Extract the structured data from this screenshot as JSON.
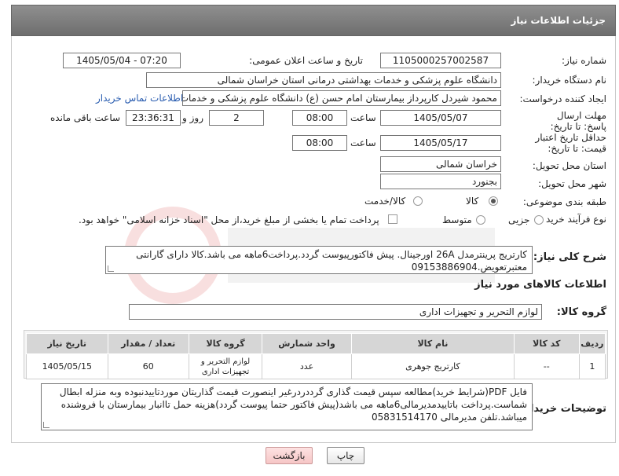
{
  "header": {
    "title": "جزئیات اطلاعات نیاز"
  },
  "labels": {
    "need_number": "شماره نیاز:",
    "announce_datetime": "تاریخ و ساعت اعلان عمومی:",
    "buyer_org": "نام دستگاه خریدار:",
    "requester": "ایجاد کننده درخواست:",
    "reply_deadline": "مهلت ارسال پاسخ: تا تاریخ:",
    "hour": "ساعت",
    "day_and": "روز و",
    "remaining": "ساعت باقی مانده",
    "price_validity": "حداقل تاریخ اعتبار قیمت: تا تاریخ:",
    "delivery_province": "استان محل تحویل:",
    "delivery_city": "شهر محل تحویل:",
    "category": "طبقه بندی موضوعی:",
    "process_type": "نوع فرآیند خرید :",
    "description_title": "شرح کلی نیاز:",
    "goods_info_title": "اطلاعات کالاهای مورد نیاز",
    "goods_group": "گروه کالا:",
    "buyer_notes": "توضیحات خریدار:"
  },
  "fields": {
    "need_number": "1105000257002587",
    "announce_datetime": "1405/05/04 - 07:20",
    "buyer_org": "دانشگاه علوم پزشکی و خدمات بهداشتی درمانی استان خراسان شمالی",
    "requester": "محمود شیردل کارپرداز بیمارستان امام حسن (ع) دانشگاه علوم پزشکی و خدمات",
    "contact_link": "اطلاعات تماس خریدار",
    "reply_date": "1405/05/07",
    "reply_time": "08:00",
    "days": "2",
    "remaining_time": "23:36:31",
    "validity_date": "1405/05/17",
    "validity_time": "08:00",
    "province": "خراسان شمالی",
    "city": "بجنورد",
    "goods_group": "لوازم التحریر و تجهیزات اداری"
  },
  "category_options": {
    "goods": "کالا",
    "goods_service": "کالا/خدمت"
  },
  "process_options": {
    "partial": "جزیی",
    "medium": "متوسط",
    "payment_note": "پرداخت تمام یا بخشی از مبلغ خرید،از محل \"اسناد خزانه اسلامی\" خواهد بود."
  },
  "description": "کارتریج پرینترمدل 26A اورجینال. پیش فاکتورپیوست گردد.پرداخت6ماهه می باشد.کالا دارای گارانتی معتبرتعویض.09153886904",
  "table": {
    "headers": [
      "ردیف",
      "کد کالا",
      "نام کالا",
      "واحد شمارش",
      "گروه کالا",
      "تعداد / مقدار",
      "تاریخ نیاز"
    ],
    "rows": [
      [
        "1",
        "--",
        "کارتریج جوهری",
        "عدد",
        "لوازم التحریر و تجهیزات اداری",
        "60",
        "1405/05/15"
      ]
    ]
  },
  "buyer_notes": "فایل PDF(شرایط خرید)مطالعه سپس قیمت گذاری گرددردرغیر اینصورت قیمت گذاریتان موردتاییدنبوده وبه منزله ابطال شماست.پرداخت باتاییدمدیرمالی6ماهه می باشد(پیش فاکتور حتما پیوست گردد)هزینه حمل تاانبار بیمارستان با فروشنده میباشد.تلفن مدیرمالی 05831514170",
  "buttons": {
    "print": "چاپ",
    "back": "بازگشت"
  },
  "colors": {
    "header_bg": "#7a7a7a",
    "link": "#2a5db0",
    "back_button": "#f6c6c6"
  }
}
